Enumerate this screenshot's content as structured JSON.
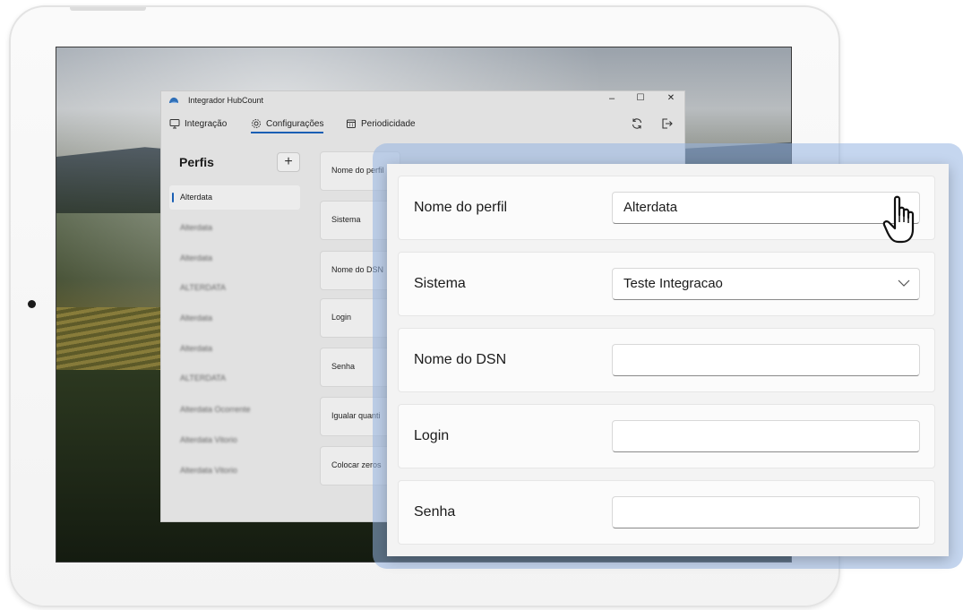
{
  "app": {
    "title": "Integrador HubCount",
    "window_controls": {
      "minimize": "–",
      "maximize": "☐",
      "close": "✕"
    },
    "nav": {
      "tabs": [
        {
          "label": "Integração",
          "icon": "monitor-icon"
        },
        {
          "label": "Configurações",
          "icon": "gear-icon",
          "active": true
        },
        {
          "label": "Periodicidade",
          "icon": "calendar-icon"
        }
      ],
      "actions": [
        {
          "icon": "sync-icon"
        },
        {
          "icon": "logout-icon"
        }
      ]
    },
    "sidebar": {
      "title": "Perfis",
      "add_label": "+",
      "items": [
        {
          "label": "Alterdata",
          "active": true
        },
        {
          "label": "Alterdata"
        },
        {
          "label": "Alterdata"
        },
        {
          "label": "ALTERDATA"
        },
        {
          "label": "Alterdata"
        },
        {
          "label": "Alterdata"
        },
        {
          "label": "ALTERDATA"
        },
        {
          "label": "Alterdata Ocorrente"
        },
        {
          "label": "Alterdata Vitorio"
        },
        {
          "label": "Alterdata Vitorio"
        }
      ]
    },
    "fields": [
      {
        "label": "Nome do perfil"
      },
      {
        "label": "Sistema"
      },
      {
        "label": "Nome do DSN"
      },
      {
        "label": "Login"
      },
      {
        "label": "Senha"
      },
      {
        "label": "Igualar quanti"
      },
      {
        "label": "Colocar zeros"
      }
    ]
  },
  "zoom": {
    "rows": [
      {
        "label": "Nome do perfil",
        "value": "Alterdata",
        "type": "text"
      },
      {
        "label": "Sistema",
        "value": "Teste Integracao",
        "type": "select"
      },
      {
        "label": "Nome do DSN",
        "value": "",
        "type": "text"
      },
      {
        "label": "Login",
        "value": "",
        "type": "text"
      },
      {
        "label": "Senha",
        "value": "",
        "type": "password"
      }
    ]
  },
  "colors": {
    "accent": "#1a5fb4",
    "halo": "#96b4e1"
  }
}
